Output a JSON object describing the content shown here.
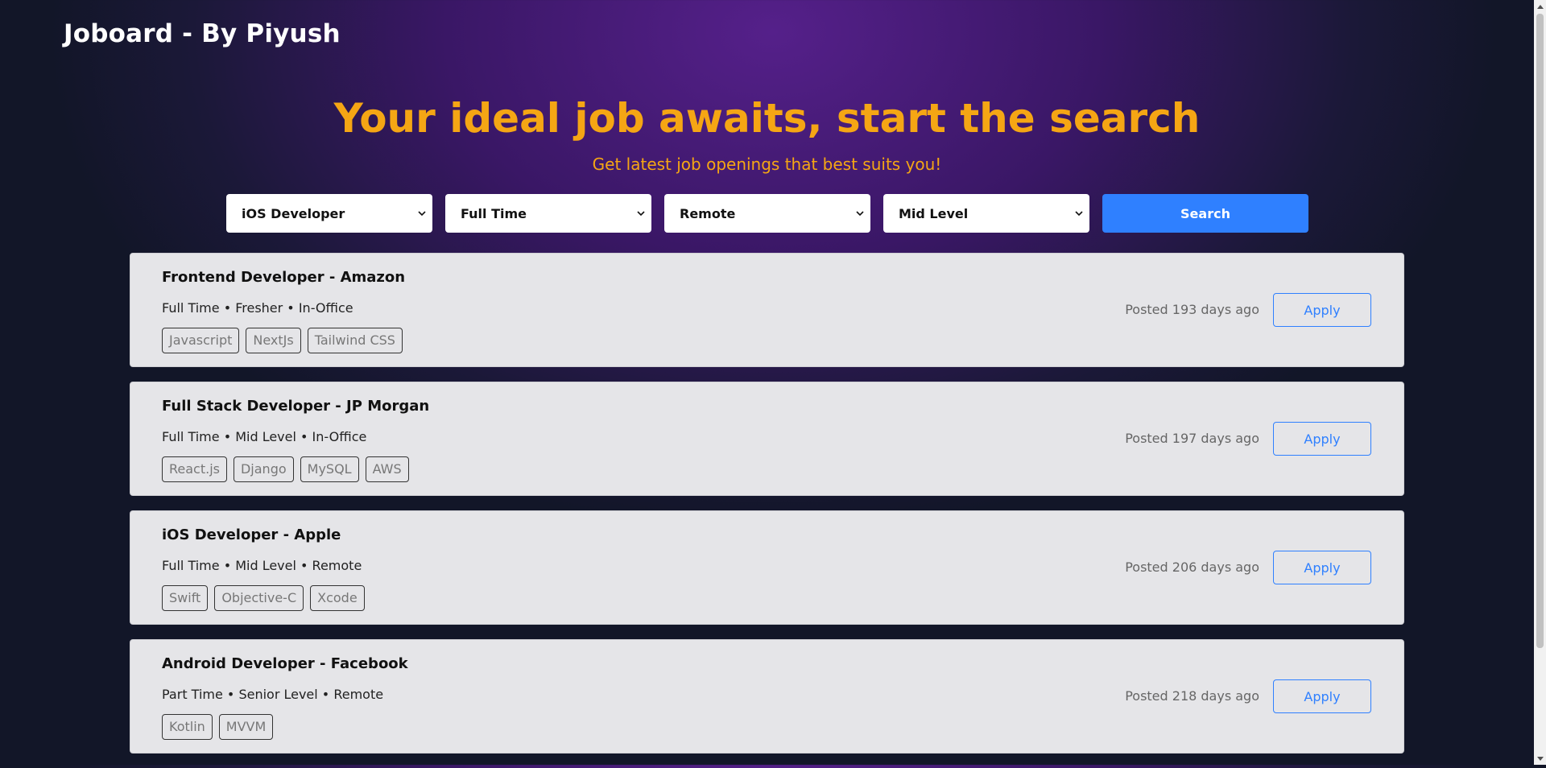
{
  "header": {
    "brand": "Joboard - By Piyush"
  },
  "hero": {
    "title": "Your ideal job awaits, start the search",
    "subtitle": "Get latest job openings that best suits you!"
  },
  "filters": {
    "role": "iOS Developer",
    "type": "Full Time",
    "location": "Remote",
    "level": "Mid Level",
    "search_label": "Search"
  },
  "jobs": [
    {
      "title": "Frontend Developer - Amazon",
      "meta": "Full Time • Fresher • In-Office",
      "tags": [
        "Javascript",
        "NextJs",
        "Tailwind CSS"
      ],
      "posted": "Posted 193 days ago",
      "apply_label": "Apply"
    },
    {
      "title": "Full Stack Developer - JP Morgan",
      "meta": "Full Time • Mid Level • In-Office",
      "tags": [
        "React.js",
        "Django",
        "MySQL",
        "AWS"
      ],
      "posted": "Posted 197 days ago",
      "apply_label": "Apply"
    },
    {
      "title": "iOS Developer - Apple",
      "meta": "Full Time • Mid Level • Remote",
      "tags": [
        "Swift",
        "Objective-C",
        "Xcode"
      ],
      "posted": "Posted 206 days ago",
      "apply_label": "Apply"
    },
    {
      "title": "Android Developer - Facebook",
      "meta": "Part Time • Senior Level • Remote",
      "tags": [
        "Kotlin",
        "MVVM"
      ],
      "posted": "Posted 218 days ago",
      "apply_label": "Apply"
    }
  ],
  "colors": {
    "accent": "#f5a614",
    "primary": "#2f80ff",
    "card_bg": "#e5e5e8"
  }
}
